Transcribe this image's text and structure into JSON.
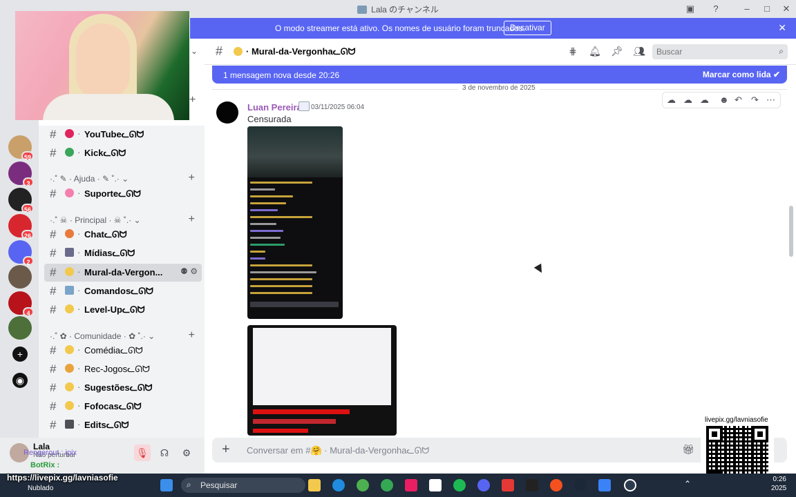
{
  "window": {
    "title": "Lala のチャンネル"
  },
  "banner": {
    "text": "O modo streamer está ativo. Os nomes de usuário foram truncados.",
    "button": "Desativar"
  },
  "servers": [
    {
      "badge": "59",
      "color": "#c9a06a"
    },
    {
      "badge": "3",
      "color": "#7a2d7e"
    },
    {
      "badge": "56",
      "color": "#222222"
    },
    {
      "badge": "26",
      "color": "#d8262f"
    },
    {
      "badge": "2",
      "color": "#5865f2"
    },
    {
      "badge": "",
      "color": "#6b5a4a"
    },
    {
      "badge": "4",
      "color": "#b8121b"
    },
    {
      "badge": "",
      "color": "#4d6f3a"
    }
  ],
  "sidebar": {
    "channels_top": [
      {
        "label": "YouTube",
        "emoji": "heart",
        "color": "#e0245e"
      },
      {
        "label": "Kick",
        "emoji": "green-heart",
        "color": "#3ba55c"
      }
    ],
    "category_ajuda": "Ajuda",
    "channels_ajuda": [
      {
        "label": "Suporte",
        "emoji": "brain",
        "color": "#f47fae"
      }
    ],
    "category_principal": "Principal",
    "channels_principal": [
      {
        "label": "Chat",
        "emoji": "face",
        "color": "#e87a3c"
      },
      {
        "label": "Mídias",
        "emoji": "vhs",
        "color": "#6a6a8a"
      },
      {
        "label": "Mural-da-Vergon...",
        "emoji": "face-blush",
        "color": "#f2c94c"
      },
      {
        "label": "Comandos",
        "emoji": "robot",
        "color": "#7aa4c8"
      },
      {
        "label": "Level-Up",
        "emoji": "star",
        "color": "#f2c94c"
      }
    ],
    "category_comunidade": "Comunidade",
    "channels_comunidade": [
      {
        "label": "Comédia",
        "emoji": "laugh",
        "color": "#f2c94c"
      },
      {
        "label": "Rec-Jogos",
        "emoji": "controller",
        "color": "#e8a33c"
      },
      {
        "label": "Sugestões",
        "emoji": "hand",
        "color": "#f2c94c"
      },
      {
        "label": "Fofocas",
        "emoji": "shush",
        "color": "#f2c94c"
      },
      {
        "label": "Edits",
        "emoji": "clapper",
        "color": "#4e5058"
      }
    ],
    "suffix": "ᓚᘏᗢ"
  },
  "user_panel": {
    "name": "Lala",
    "status": "Não perturbar",
    "overlay_1": "Rengerout : ipix",
    "overlay_2": "BotRix :"
  },
  "channel_header": {
    "name": "Mural-da-Vergonha",
    "suffix": "ᓚᘏᗢ",
    "search_placeholder": "Buscar"
  },
  "new_messages": {
    "text": "1 mensagem nova desde 20:26",
    "mark_read": "Marcar como lida"
  },
  "date_separator": "3 de novembro de 2025",
  "message": {
    "author": "Luan Pereira",
    "timestamp": "03/11/2025 06:04",
    "content": "Censurada"
  },
  "composer": {
    "placeholder": "Conversar em #🤗 · Mural-da-Vergonhaᓚᘏᗢ"
  },
  "qr": {
    "label": "livepix.gg/lavniasofie"
  },
  "stream_link": "https://livepix.gg/lavniasofie",
  "weather": "Nublado",
  "taskbar": {
    "search": "Pesquisar",
    "time": "0:26",
    "year": "2025"
  }
}
